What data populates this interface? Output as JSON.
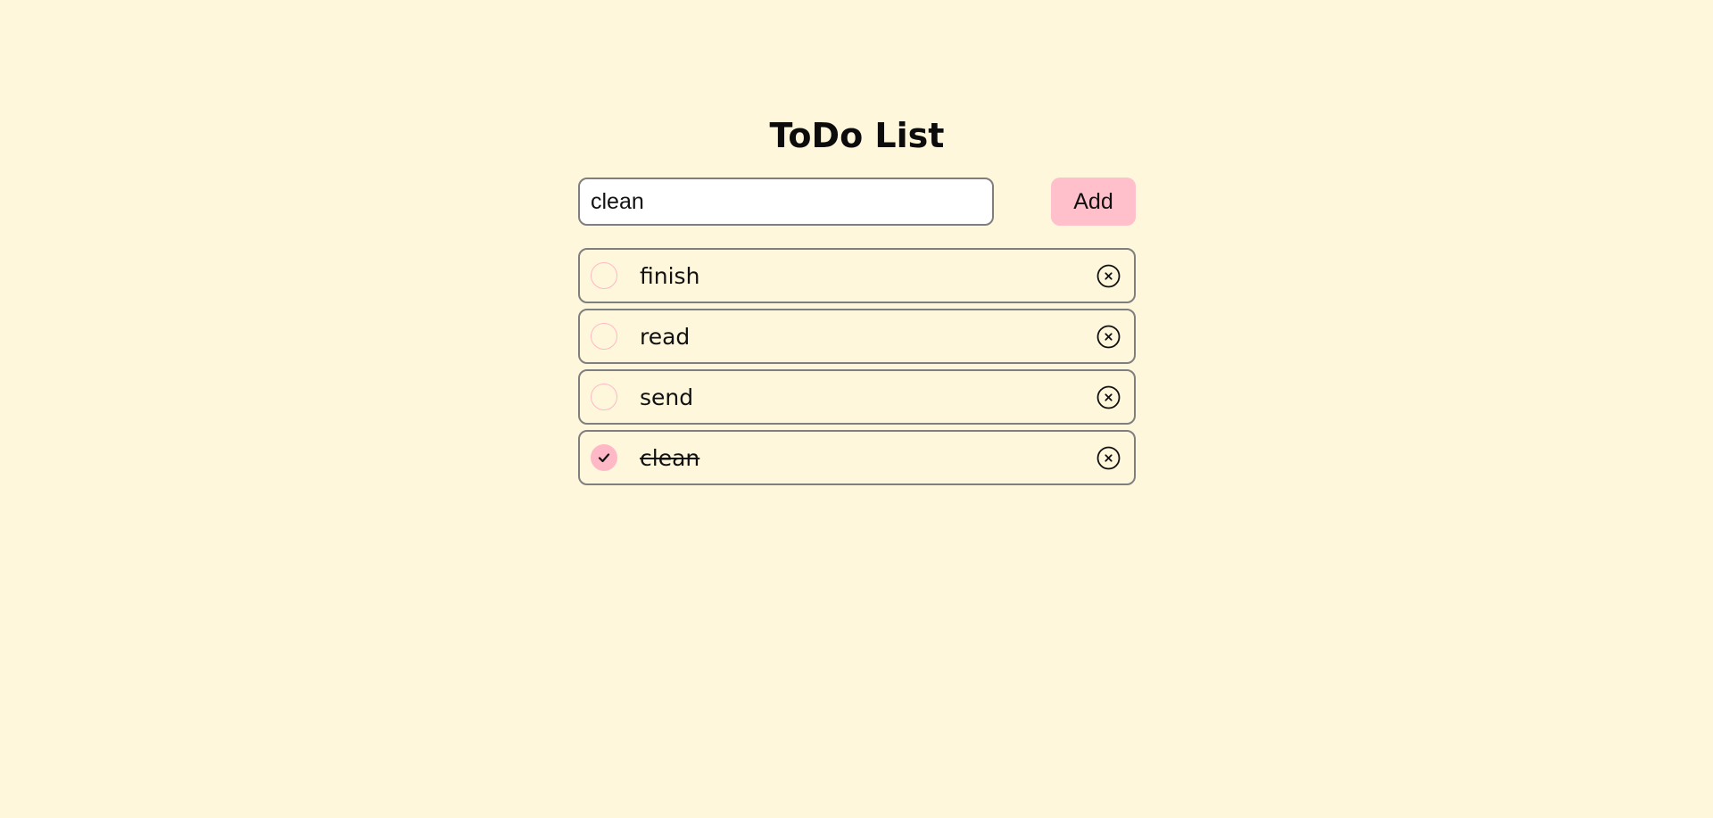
{
  "app": {
    "title": "ToDo List"
  },
  "form": {
    "input_value": "clean",
    "add_label": "Add"
  },
  "todos": [
    {
      "text": "finish",
      "done": false
    },
    {
      "text": "read",
      "done": false
    },
    {
      "text": "send",
      "done": false
    },
    {
      "text": "clean",
      "done": true
    }
  ],
  "icons": {
    "check": "checkmark-icon",
    "delete": "close-circle-icon"
  },
  "colors": {
    "background": "#fff7dc",
    "accent": "#ffc0cb",
    "border": "#7f7f7f"
  }
}
